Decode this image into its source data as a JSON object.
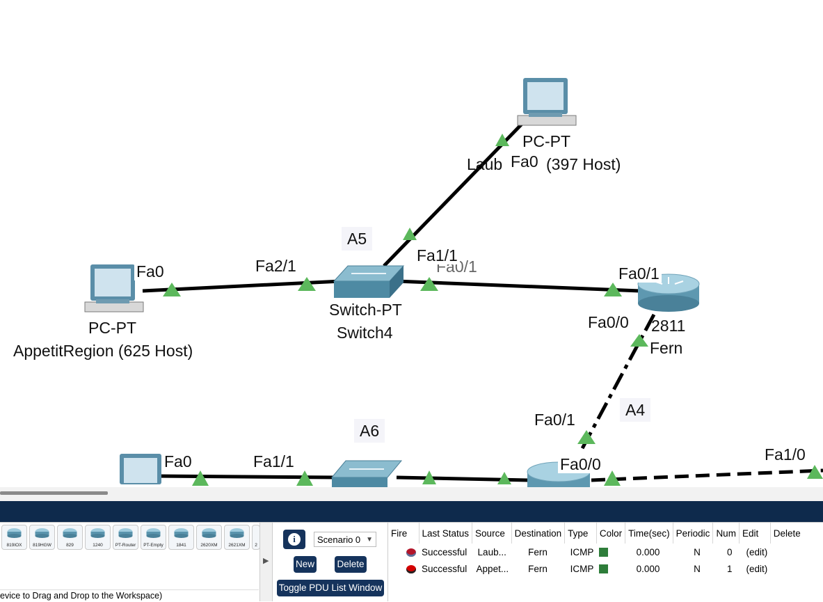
{
  "workspace": {
    "devices": {
      "laub_type": "PC-PT",
      "laub_name": "Laub",
      "laub_host": "(397 Host)",
      "appetit_type": "PC-PT",
      "appetit_name": "AppetitRegion (625 Host)",
      "switch4_type": "Switch-PT",
      "switch4_name": "Switch4",
      "fern_type": "2811",
      "fern_name": "Fern"
    },
    "ports": {
      "laub_fa0": "Fa0",
      "appetit_fa0": "Fa0",
      "sw4_fa2_1": "Fa2/1",
      "sw4_fa1_1": "Fa1/1",
      "sw4_fa0_1_hidden": "Fa0/1",
      "fern_fa0_1": "Fa0/1",
      "fern_fa0_0": "Fa0/0",
      "lower_router_fa0_1": "Fa0/1",
      "lower_pc_fa0": "Fa0",
      "sw6_fa1_1": "Fa1/1",
      "lower_router_fa0_0": "Fa0/0",
      "right_fa1_0": "Fa1/0"
    },
    "area_labels": {
      "a5": "A5",
      "a4": "A4",
      "a6": "A6"
    }
  },
  "device_panel": {
    "items": [
      "819IOX",
      "819HGW",
      "829",
      "1240",
      "PT-Router",
      "PT-Empty",
      "1841",
      "2620XM",
      "2621XM",
      "2"
    ],
    "hint": "evice to Drag and Drop to the Workspace)"
  },
  "scenario": {
    "info_icon": "info-icon",
    "selected": "Scenario 0",
    "new_label": "New",
    "delete_label": "Delete",
    "toggle_label": "Toggle PDU List Window"
  },
  "pdu_list": {
    "columns": [
      "Fire",
      "Last Status",
      "Source",
      "Destination",
      "Type",
      "Color",
      "Time(sec)",
      "Periodic",
      "Num",
      "Edit",
      "Delete"
    ],
    "rows": [
      {
        "status": "Successful",
        "source": "Laub...",
        "destination": "Fern",
        "type": "ICMP",
        "color": "#2e7d3a",
        "time": "0.000",
        "periodic": "N",
        "num": "0",
        "edit": "(edit)",
        "dot_color": "#b3152a"
      },
      {
        "status": "Successful",
        "source": "Appet...",
        "destination": "Fern",
        "type": "ICMP",
        "color": "#2e7d3a",
        "time": "0.000",
        "periodic": "N",
        "num": "1",
        "edit": "(edit)",
        "dot_color": "#d40000"
      }
    ]
  },
  "colors": {
    "topbar": "#0e2a4c",
    "button": "#15335c",
    "link_up": "#5cb85c"
  }
}
